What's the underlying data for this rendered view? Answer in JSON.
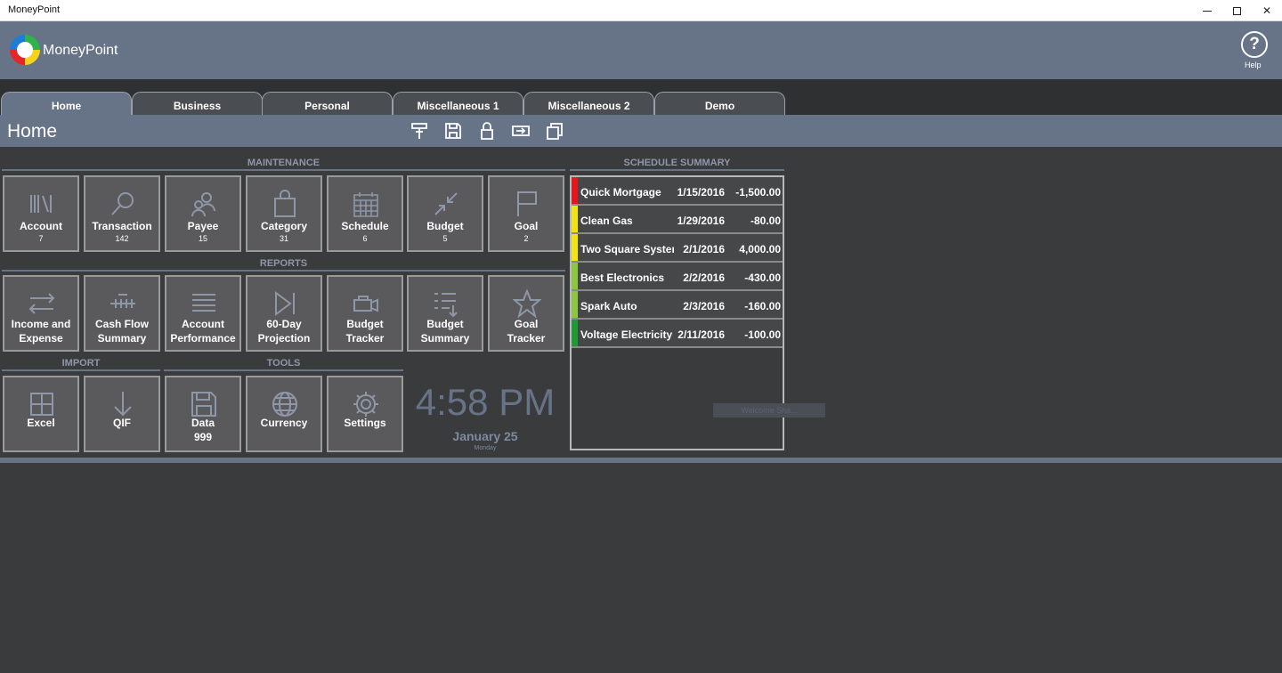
{
  "window": {
    "title": "MoneyPoint"
  },
  "app": {
    "name": "MoneyPoint",
    "help_label": "Help",
    "help_glyph": "?"
  },
  "tabs": [
    {
      "label": "Home",
      "active": true
    },
    {
      "label": "Business"
    },
    {
      "label": "Personal"
    },
    {
      "label": "Miscellaneous 1"
    },
    {
      "label": "Miscellaneous 2"
    },
    {
      "label": "Demo"
    }
  ],
  "page": {
    "title": "Home"
  },
  "toolbar_icons": [
    "pin-icon",
    "save-icon",
    "lock-icon",
    "export-icon",
    "copy-icon"
  ],
  "sections": {
    "maintenance": "MAINTENANCE",
    "reports": "REPORTS",
    "import": "IMPORT",
    "tools": "TOOLS",
    "schedule_summary": "SCHEDULE SUMMARY"
  },
  "maintenance_tiles": [
    {
      "label": "Account",
      "count": "7",
      "icon": "books-icon"
    },
    {
      "label": "Transaction",
      "count": "142",
      "icon": "magnifier-icon"
    },
    {
      "label": "Payee",
      "count": "15",
      "icon": "people-icon"
    },
    {
      "label": "Category",
      "count": "31",
      "icon": "shopping-bag-icon"
    },
    {
      "label": "Schedule",
      "count": "6",
      "icon": "calendar-icon"
    },
    {
      "label": "Budget",
      "count": "5",
      "icon": "compress-arrows-icon"
    },
    {
      "label": "Goal",
      "count": "2",
      "icon": "flag-icon"
    }
  ],
  "report_tiles": [
    {
      "line1": "Income and",
      "line2": "Expense",
      "icon": "transfer-arrows-icon"
    },
    {
      "line1": "Cash Flow",
      "line2": "Summary",
      "icon": "flow-icon"
    },
    {
      "line1": "Account",
      "line2": "Performance",
      "icon": "list-icon"
    },
    {
      "line1": "60-Day",
      "line2": "Projection",
      "icon": "skip-forward-icon"
    },
    {
      "line1": "Budget",
      "line2": "Tracker",
      "icon": "tracker-icon"
    },
    {
      "line1": "Budget",
      "line2": "Summary",
      "icon": "bullet-list-icon"
    },
    {
      "line1": "Goal",
      "line2": "Tracker",
      "icon": "star-icon"
    }
  ],
  "import_tiles": [
    {
      "label": "Excel",
      "icon": "grid-icon"
    },
    {
      "label": "QIF",
      "icon": "download-arrow-icon"
    }
  ],
  "tool_tiles": [
    {
      "label": "Data",
      "count": "999",
      "icon": "floppy-icon"
    },
    {
      "label": "Currency",
      "icon": "globe-icon"
    },
    {
      "label": "Settings",
      "icon": "gear-icon"
    }
  ],
  "clock": {
    "time": "4:58 PM",
    "date": "January 25",
    "weekday": "Monday"
  },
  "schedule": [
    {
      "name": "Quick Mortgage",
      "date": "1/15/2016",
      "amount": "-1,500.00",
      "color": "#e8141b"
    },
    {
      "name": "Clean Gas",
      "date": "1/29/2016",
      "amount": "-80.00",
      "color": "#f2e313"
    },
    {
      "name": "Two Square Systems",
      "date": "2/1/2016",
      "amount": "4,000.00",
      "color": "#f2e313"
    },
    {
      "name": "Best Electronics",
      "date": "2/2/2016",
      "amount": "-430.00",
      "color": "#8cc63f"
    },
    {
      "name": "Spark Auto",
      "date": "2/3/2016",
      "amount": "-160.00",
      "color": "#8cc63f"
    },
    {
      "name": "Voltage Electricity",
      "date": "2/11/2016",
      "amount": "-100.00",
      "color": "#1f9b35"
    }
  ],
  "watermark": "Welcome Sha..."
}
